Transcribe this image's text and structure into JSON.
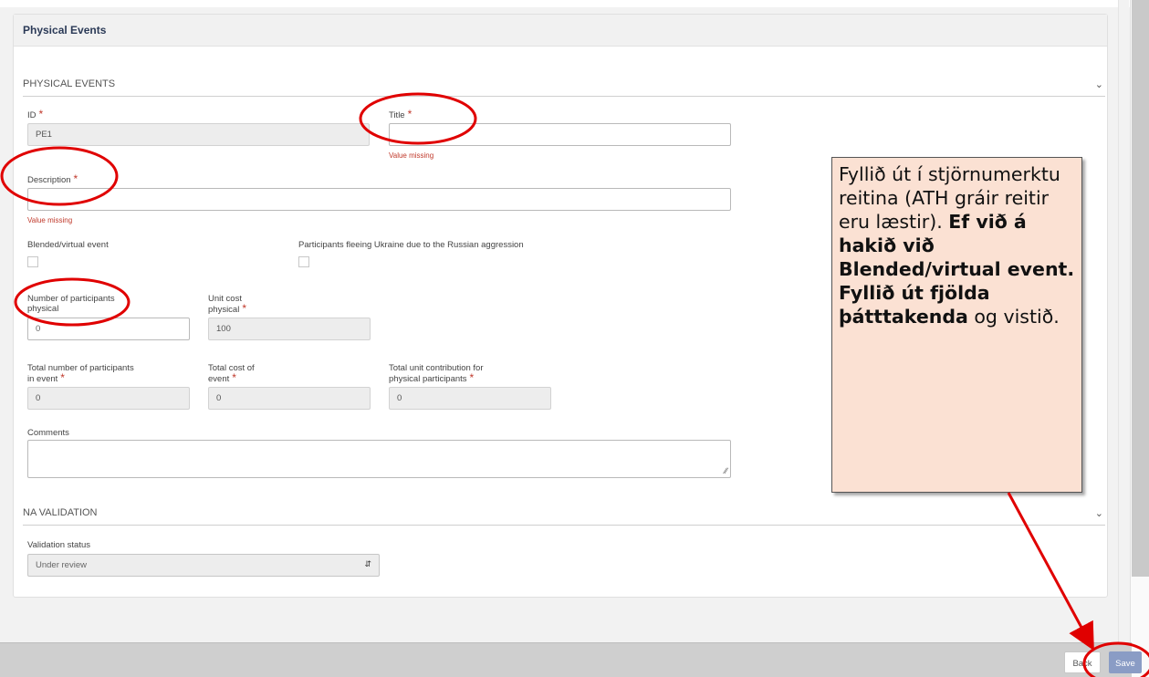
{
  "panel": {
    "title": "Physical Events"
  },
  "sections": {
    "physical": "PHYSICAL EVENTS",
    "na": "NA VALIDATION"
  },
  "fields": {
    "id": {
      "label": "ID",
      "value": "PE1"
    },
    "title": {
      "label": "Title",
      "value": "",
      "error": "Value missing"
    },
    "description": {
      "label": "Description",
      "value": "",
      "error": "Value missing"
    },
    "blended": {
      "label": "Blended/virtual event"
    },
    "ukraine": {
      "label": "Participants fleeing Ukraine due to the Russian aggression"
    },
    "num_participants": {
      "label_line1": "Number of participants",
      "label_line2": "physical",
      "value": "0"
    },
    "unit_cost": {
      "label_line1": "Unit cost",
      "label_line2": "physical",
      "value": "100"
    },
    "total_participants": {
      "label_line1": "Total number of participants",
      "label_line2": "in event",
      "value": "0"
    },
    "total_cost": {
      "label_line1": "Total cost of",
      "label_line2": "event",
      "value": "0"
    },
    "total_unit_contrib": {
      "label_line1": "Total unit contribution for",
      "label_line2": "physical participants",
      "value": "0"
    },
    "comments": {
      "label": "Comments"
    },
    "validation_status": {
      "label": "Validation status",
      "value": "Under review"
    }
  },
  "required_mark": "*",
  "footer": {
    "back_label": "Back",
    "save_label": "Save"
  },
  "callout": {
    "text_normal_1": "Fyllið út í stjörnumerktu reitina (ATH gráir reitir eru læstir).",
    "text_bold": "Ef við á hakið við Blended/virtual event. Fyllið út fjölda þátttakenda",
    "text_normal_2": "og vistið."
  },
  "colors": {
    "accent_red": "#e00000",
    "save_button": "#8a9cc5",
    "callout_bg": "#fbe1d3",
    "required": "#c0392b"
  }
}
